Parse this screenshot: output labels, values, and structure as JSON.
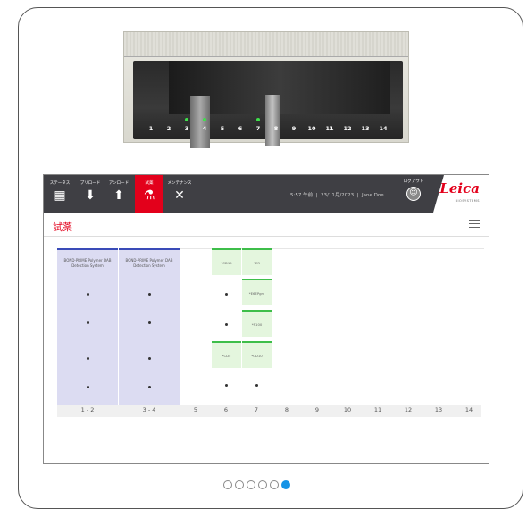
{
  "device": {
    "slot_numbers": [
      "1",
      "2",
      "3",
      "4",
      "5",
      "6",
      "7",
      "8",
      "9",
      "10",
      "11",
      "12",
      "13",
      "14"
    ],
    "lit_slots": [
      3,
      4,
      7
    ]
  },
  "app": {
    "nav": [
      {
        "label": "ステータス",
        "icon": "slide-tray-icon"
      },
      {
        "label": "プリロード",
        "icon": "load-icon"
      },
      {
        "label": "アンロード",
        "icon": "unload-icon"
      },
      {
        "label": "試薬",
        "icon": "reagent-icon"
      },
      {
        "label": "メンテナンス",
        "icon": "tools-icon"
      }
    ],
    "status": {
      "time": "5:57 午前",
      "date": "23/11月/2023",
      "user": "Jane Doe"
    },
    "logout_label": "ログアウト",
    "logo": "Leica",
    "logo_sub": "BIOSYSTEMS",
    "title": "試薬",
    "detection_label": "BOND-PRIME Polymer DAB Detection System",
    "column_labels": [
      "1 - 2",
      "3 - 4",
      "5",
      "6",
      "7",
      "8",
      "9",
      "10",
      "11",
      "12",
      "13",
      "14"
    ],
    "reagents_col6": [
      "*CD15",
      "*CD5"
    ],
    "reagents_col7": [
      "*ER",
      "*E6EPgm",
      "*S100",
      "*CD10"
    ]
  },
  "pager": {
    "count": 6,
    "active": 6
  },
  "colors": {
    "accent": "#e3001b",
    "pager_active": "#1593e6",
    "reagent_green": "#3ebe4a",
    "detection_blue": "#3a4bb8"
  }
}
